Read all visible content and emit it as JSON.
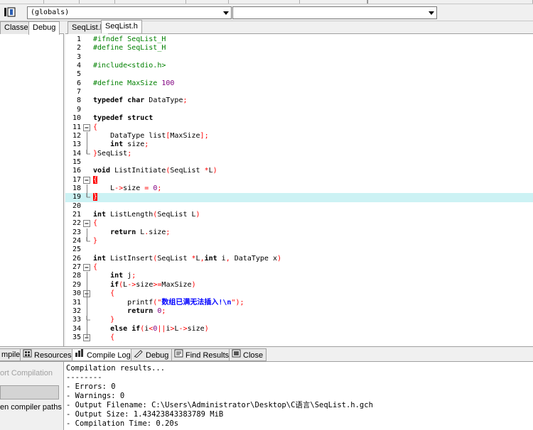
{
  "toolbar": {
    "scope_combo_value": "(globals)",
    "symbol_combo_value": ""
  },
  "left_panel": {
    "tabs": [
      {
        "label": "Classes"
      },
      {
        "label": "Debug"
      }
    ]
  },
  "editor": {
    "tabs": [
      {
        "label": "SeqList.h"
      },
      {
        "label": "SeqList.h"
      }
    ]
  },
  "code_lines": [
    {
      "n": "1",
      "text": "#ifndef SeqList_H"
    },
    {
      "n": "2",
      "text": "#define SeqList_H"
    },
    {
      "n": "3",
      "text": ""
    },
    {
      "n": "4",
      "text": "#include<stdio.h>"
    },
    {
      "n": "5",
      "text": ""
    },
    {
      "n": "6",
      "text": "#define MaxSize 100"
    },
    {
      "n": "7",
      "text": ""
    },
    {
      "n": "8",
      "text": "typedef char DataType;"
    },
    {
      "n": "9",
      "text": ""
    },
    {
      "n": "10",
      "text": "typedef struct"
    },
    {
      "n": "11",
      "text": "{"
    },
    {
      "n": "12",
      "text": "    DataType list[MaxSize];"
    },
    {
      "n": "13",
      "text": "    int size;"
    },
    {
      "n": "14",
      "text": "}SeqList;"
    },
    {
      "n": "15",
      "text": ""
    },
    {
      "n": "16",
      "text": "void ListInitiate(SeqList *L)"
    },
    {
      "n": "17",
      "text": "{"
    },
    {
      "n": "18",
      "text": "    L->size = 0;"
    },
    {
      "n": "19",
      "text": "}"
    },
    {
      "n": "20",
      "text": ""
    },
    {
      "n": "21",
      "text": "int ListLength(SeqList L)"
    },
    {
      "n": "22",
      "text": "{"
    },
    {
      "n": "23",
      "text": "    return L.size;"
    },
    {
      "n": "24",
      "text": "}"
    },
    {
      "n": "25",
      "text": ""
    },
    {
      "n": "26",
      "text": "int ListInsert(SeqList *L,int i, DataType x)"
    },
    {
      "n": "27",
      "text": "{"
    },
    {
      "n": "28",
      "text": "    int j;"
    },
    {
      "n": "29",
      "text": "    if(L->size>=MaxSize)"
    },
    {
      "n": "30",
      "text": "    {"
    },
    {
      "n": "31",
      "text": "        printf(\"数组已满无法插入!\\n\");"
    },
    {
      "n": "32",
      "text": "        return 0;"
    },
    {
      "n": "33",
      "text": "    }"
    },
    {
      "n": "34",
      "text": "    else if(i<0||i>L->size)"
    },
    {
      "n": "35",
      "text": "    {"
    }
  ],
  "highlighted_line": 19,
  "bottom_tabs": [
    {
      "label": "mpiler",
      "icon": "compiler-icon"
    },
    {
      "label": "Resources",
      "icon": "resources-icon"
    },
    {
      "label": "Compile Log",
      "icon": "compile-log-icon"
    },
    {
      "label": "Debug",
      "icon": "debug-icon"
    },
    {
      "label": "Find Results",
      "icon": "find-results-icon"
    },
    {
      "label": "Close",
      "icon": "close-icon"
    }
  ],
  "bottom_left": {
    "abort_label": "ort Compilation",
    "paths_label": "en compiler paths"
  },
  "compile_log": {
    "lines": [
      "Compilation results...",
      "--------",
      "- Errors: 0",
      "- Warnings: 0",
      "- Output Filename: C:\\Users\\Administrator\\Desktop\\C语言\\SeqList.h.gch",
      "- Output Size: 1.43423843383789 MiB",
      "- Compilation Time: 0.20s"
    ]
  }
}
